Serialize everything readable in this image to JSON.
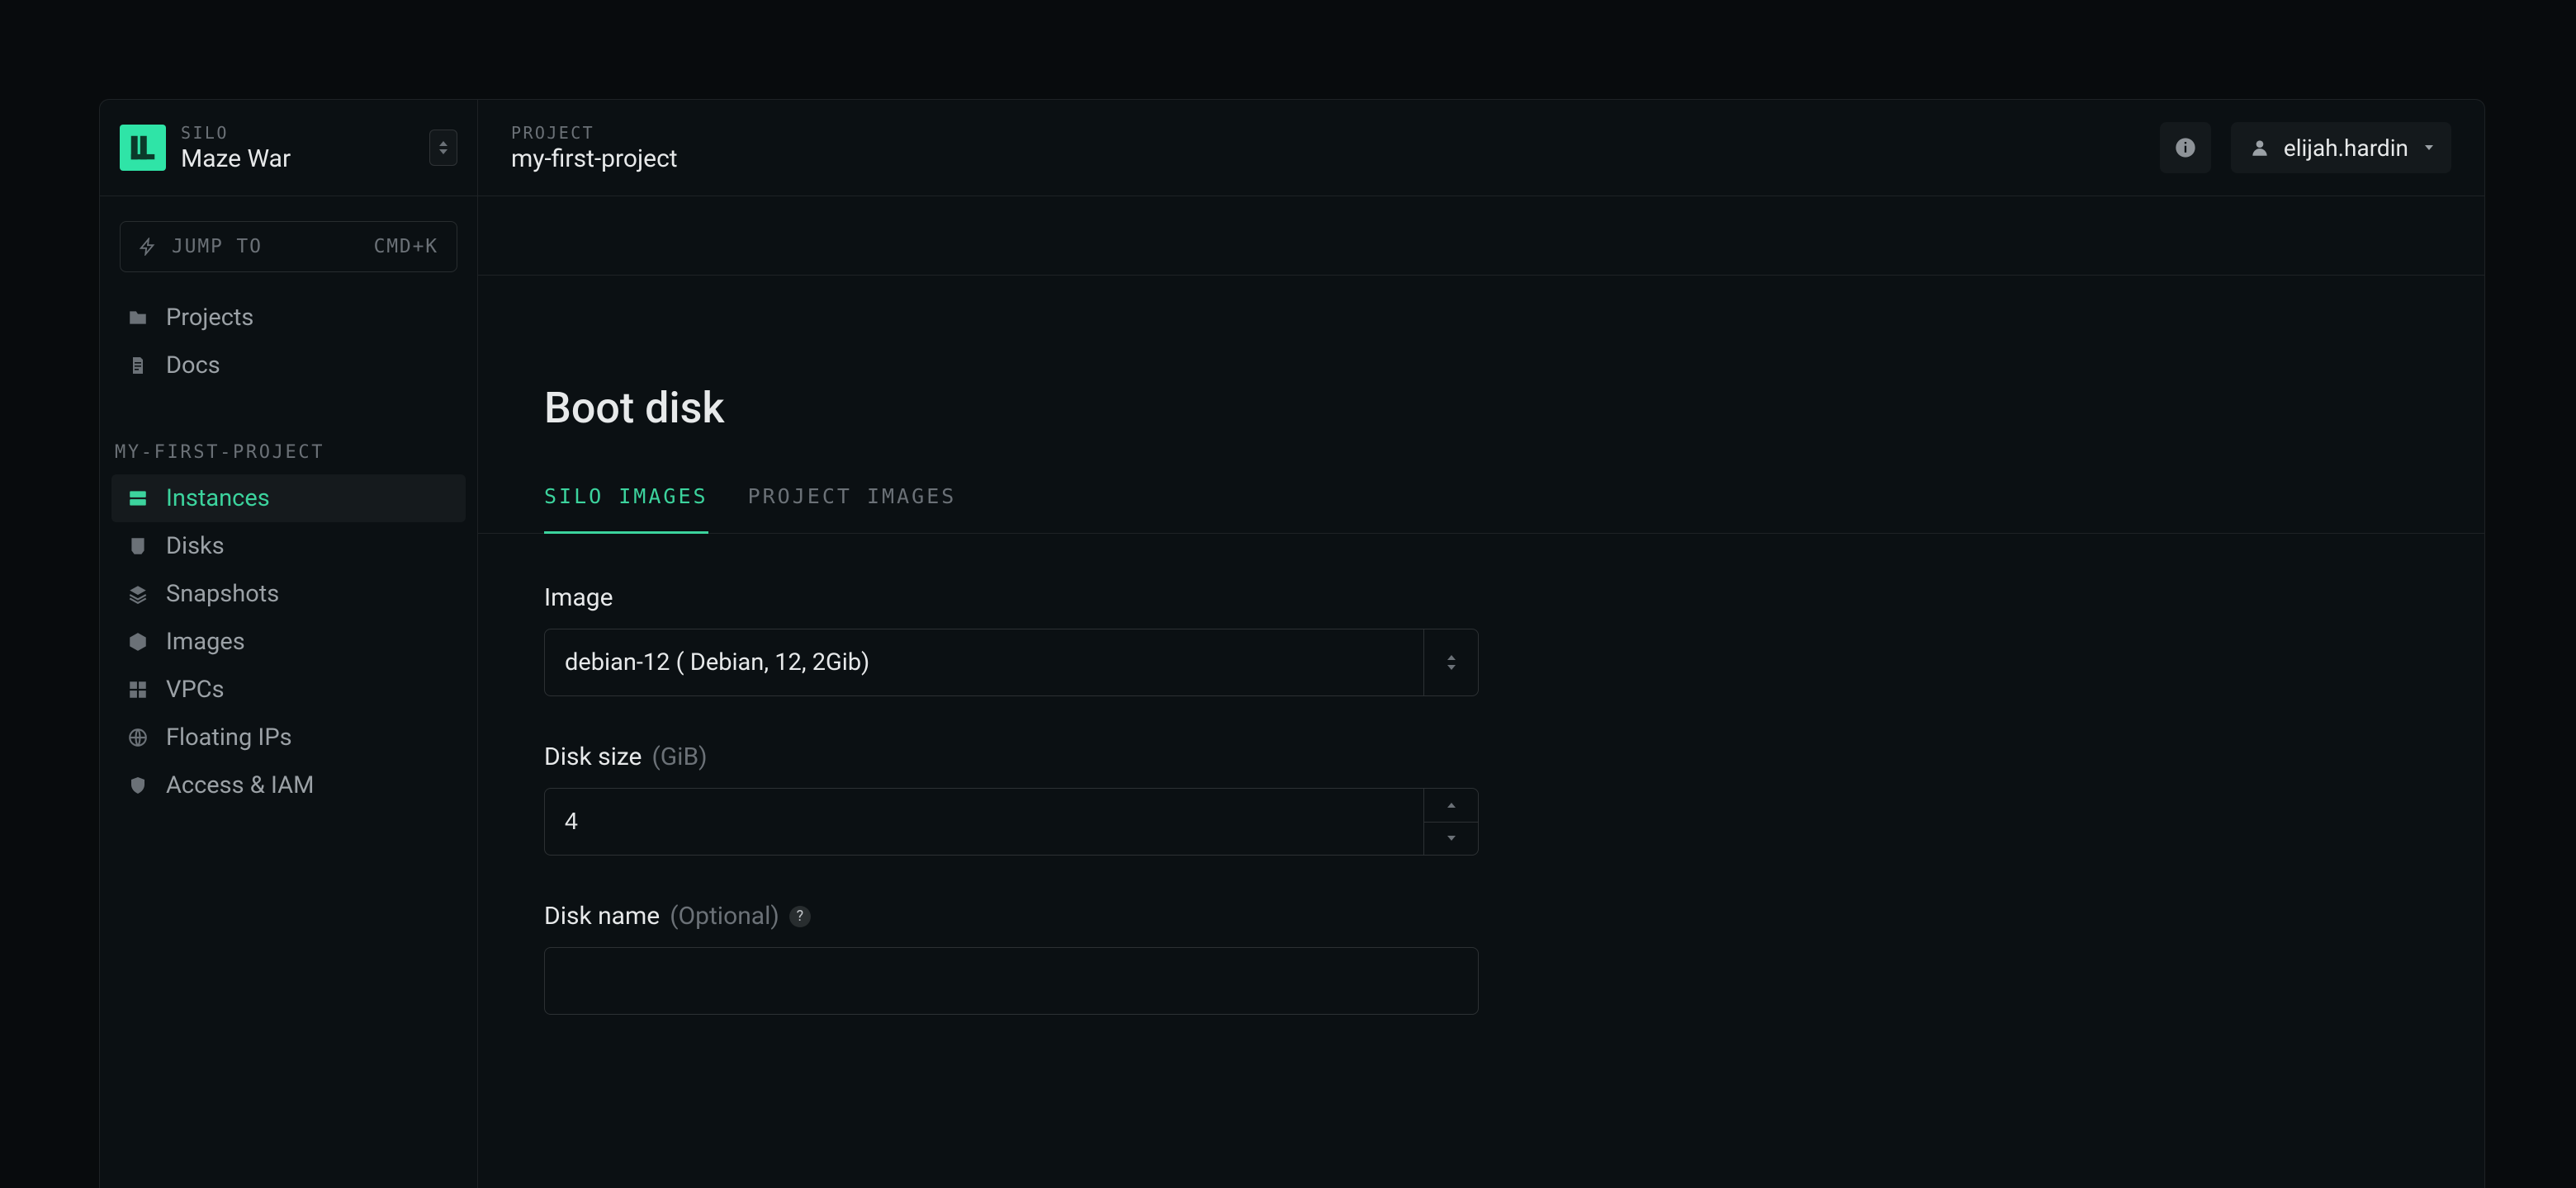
{
  "silo": {
    "label": "SILO",
    "name": "Maze War"
  },
  "jump": {
    "label": "JUMP TO",
    "shortcut": "CMD+K"
  },
  "topnav": [
    {
      "key": "projects",
      "label": "Projects",
      "icon": "folder"
    },
    {
      "key": "docs",
      "label": "Docs",
      "icon": "doc"
    }
  ],
  "project_section_label": "MY-FIRST-PROJECT",
  "projectnav": [
    {
      "key": "instances",
      "label": "Instances",
      "icon": "server",
      "active": true
    },
    {
      "key": "disks",
      "label": "Disks",
      "icon": "disk"
    },
    {
      "key": "snapshots",
      "label": "Snapshots",
      "icon": "layers"
    },
    {
      "key": "images",
      "label": "Images",
      "icon": "cube"
    },
    {
      "key": "vpcs",
      "label": "VPCs",
      "icon": "grid"
    },
    {
      "key": "floatingips",
      "label": "Floating IPs",
      "icon": "globe"
    },
    {
      "key": "access",
      "label": "Access & IAM",
      "icon": "shield"
    }
  ],
  "breadcrumb": {
    "label": "PROJECT",
    "value": "my-first-project"
  },
  "user": {
    "name": "elijah.hardin"
  },
  "page": {
    "title": "Boot disk"
  },
  "tabs": [
    {
      "key": "silo",
      "label": "SILO IMAGES",
      "active": true
    },
    {
      "key": "project",
      "label": "PROJECT IMAGES"
    }
  ],
  "form": {
    "image_label": "Image",
    "image_value": "debian-12 ( Debian, 12, 2Gib)",
    "disk_size_label": "Disk size",
    "disk_size_unit": "(GiB)",
    "disk_size_value": "4",
    "disk_name_label": "Disk name",
    "disk_name_optional": "(Optional)",
    "disk_name_value": ""
  },
  "colors": {
    "accent": "#3cd39d"
  }
}
